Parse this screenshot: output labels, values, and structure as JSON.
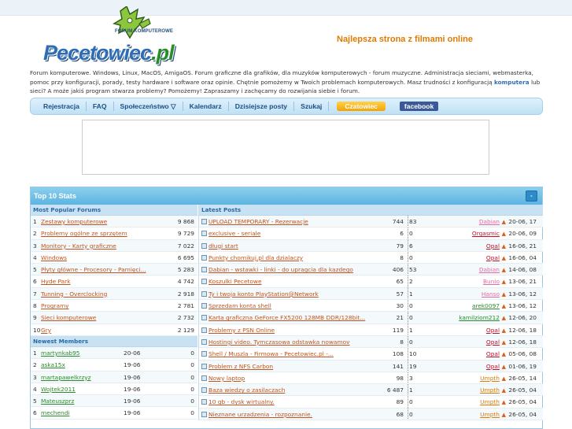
{
  "header": {
    "logo_sub": "FORUM KOMPUTEROWE",
    "logo_word": "Pecetowiec",
    "logo_tld": ".pl",
    "promo": "Najlepsza strona z filmami online"
  },
  "description": {
    "text_before": "Forum komputerowe. Windows, Linux, MacOS, AmigaOS. Forum graficzne dla grafików, dla muzyków komputerowych - forum muzyczne. Administracja sieciami, webmasterka, pomoc przy konfiguracji, porady, testy hardware i software oraz opinie. Chętnie pomożemy w Twoich problemach komputerowych. Masz trudności z konfiguracją ",
    "highlight": "komputera",
    "text_after": " lub sieci? A może jakiś program stwarza problemy? Pomożemy! Zapraszamy i zachęcamy do rozwijania siebie i forum."
  },
  "nav": {
    "items": [
      "Rejestracja",
      "FAQ",
      "Społeczeństwo ▽",
      "Kalendarz",
      "Dzisiejsze posty",
      "Szukaj"
    ],
    "chat": "Czatowiec",
    "facebook": "facebook"
  },
  "panel": {
    "title": "Top 10 Stats",
    "toggle": "-",
    "popular_head": "Most Popular Forums",
    "latest_head": "Latest Posts",
    "members_head": "Newest Members"
  },
  "forums": [
    {
      "n": "1",
      "name": "Zestawy komputerowe",
      "count": "9 868"
    },
    {
      "n": "2",
      "name": "Problemy ogólne ze sprzętem",
      "count": "9 729"
    },
    {
      "n": "3",
      "name": "Monitory - Karty graficzne",
      "count": "7 022"
    },
    {
      "n": "4",
      "name": "Windows",
      "count": "6 695"
    },
    {
      "n": "5",
      "name": "Płyty główne - Procesory - Pamięci...",
      "count": "5 283"
    },
    {
      "n": "6",
      "name": "Hyde Park",
      "count": "4 742"
    },
    {
      "n": "7",
      "name": "Tunning - Overclocking",
      "count": "2 918"
    },
    {
      "n": "8",
      "name": "Programy",
      "count": "2 781"
    },
    {
      "n": "9",
      "name": "Sieci komputerowe",
      "count": "2 732"
    },
    {
      "n": "10",
      "name": "Gry",
      "count": "2 129"
    }
  ],
  "members": [
    {
      "n": "1",
      "name": "martynkab95",
      "date": "20-06",
      "count": "0"
    },
    {
      "n": "2",
      "name": "aska15x",
      "date": "19-06",
      "count": "0"
    },
    {
      "n": "3",
      "name": "martapawelkrzyz",
      "date": "19-06",
      "count": "0"
    },
    {
      "n": "4",
      "name": "Wojtek2011",
      "date": "19-06",
      "count": "0"
    },
    {
      "n": "5",
      "name": "Mateuszprz",
      "date": "19-06",
      "count": "0"
    },
    {
      "n": "6",
      "name": "mechendi",
      "date": "19-06",
      "count": "0"
    }
  ],
  "posts": [
    {
      "title": "UPLOAD TEMPORARY - Rezerwacje",
      "views": "744",
      "replies": "83",
      "user": "Dabian",
      "ucolor": "#e86aa0",
      "time": "20-06, 17"
    },
    {
      "title": "exclusive - seriale",
      "views": "6",
      "replies": "0",
      "user": "Orgasmic",
      "ucolor": "#c0112b",
      "time": "20-06, 09"
    },
    {
      "title": "długi start",
      "views": "79",
      "replies": "6",
      "user": "Opal",
      "ucolor": "#c0112b",
      "time": "16-06, 21"
    },
    {
      "title": "Punkty chomikuj.pl dla dzialaczy",
      "views": "8",
      "replies": "0",
      "user": "Opal",
      "ucolor": "#c0112b",
      "time": "16-06, 04"
    },
    {
      "title": "Dabian - wstawki - linki - do upragcia dla kazdego",
      "views": "406",
      "replies": "53",
      "user": "Dabian",
      "ucolor": "#e86aa0",
      "time": "14-06, 08"
    },
    {
      "title": "Koszulki Pecetowe",
      "views": "65",
      "replies": "2",
      "user": "Bunio",
      "ucolor": "#e86aa0",
      "time": "13-06, 21"
    },
    {
      "title": "Ty i twoja konto PlayStation@Network",
      "views": "57",
      "replies": "1",
      "user": "Hanso",
      "ucolor": "#e86aa0",
      "time": "13-06, 12"
    },
    {
      "title": "Sprzedam konta shell",
      "views": "30",
      "replies": "0",
      "user": "arek0097",
      "ucolor": "#2a8c2a",
      "time": "13-06, 12"
    },
    {
      "title": "Karta graficzna GeForce FX5200 128MB DDR/128bit...",
      "views": "21",
      "replies": "0",
      "user": "kamilziom212",
      "ucolor": "#2a8c2a",
      "time": "12-06, 20"
    },
    {
      "title": "Problemy z PSN Online",
      "views": "119",
      "replies": "1",
      "user": "Opal",
      "ucolor": "#c0112b",
      "time": "12-06, 18"
    },
    {
      "title": "Hostingi video. Tymczasowa odstawka nowamov",
      "views": "8",
      "replies": "0",
      "user": "Opal",
      "ucolor": "#c0112b",
      "time": "12-06, 18"
    },
    {
      "title": "Shell / Muszla - Firmowa - Pecetowiec.pl -...",
      "views": "108",
      "replies": "10",
      "user": "Opal",
      "ucolor": "#c0112b",
      "time": "05-06, 08"
    },
    {
      "title": "Problem z NFS Carbon",
      "views": "141",
      "replies": "19",
      "user": "Opal",
      "ucolor": "#c0112b",
      "time": "01-06, 19"
    },
    {
      "title": "Nowy laptop",
      "views": "98",
      "replies": "3",
      "user": "Umpth",
      "ucolor": "#e07a00",
      "time": "26-05, 14"
    },
    {
      "title": "Baza wiedzy o zasilaczach",
      "views": "6 487",
      "replies": "1",
      "user": "Umpth",
      "ucolor": "#e07a00",
      "time": "26-05, 04"
    },
    {
      "title": "10 gb - dysk wirtualny.",
      "views": "89",
      "replies": "0",
      "user": "Umpth",
      "ucolor": "#e07a00",
      "time": "26-05, 04"
    },
    {
      "title": "Nieznane urzadzenia - rozpoznanie.",
      "views": "68",
      "replies": "0",
      "user": "Umpth",
      "ucolor": "#e07a00",
      "time": "26-05, 04"
    }
  ]
}
